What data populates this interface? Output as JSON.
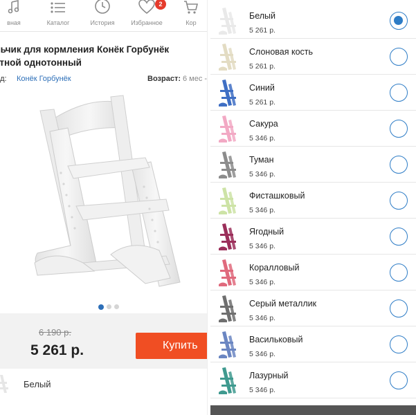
{
  "tabbar": {
    "tabs": [
      {
        "label": "вная",
        "icon": "music-note-icon"
      },
      {
        "label": "Каталог",
        "icon": "catalog-list-icon"
      },
      {
        "label": "История",
        "icon": "history-clock-icon"
      },
      {
        "label": "Избранное",
        "icon": "heart-icon",
        "badge": "2"
      },
      {
        "label": "Кор",
        "icon": "cart-icon"
      }
    ]
  },
  "product": {
    "title_line1": "льчик для кормления Конёк Горбунёк",
    "title_line2": "етной однотонный",
    "brand_key": "нд:",
    "brand_value": "Конёк Горбунёк",
    "age_key": "Возраст:",
    "age_value": "6 мес -",
    "old_price": "6 190 р.",
    "price": "5 261 р.",
    "buy_label": "Купить",
    "selected_color": "Белый",
    "gallery_pages": 3,
    "gallery_current": 1
  },
  "colors": {
    "accent": "#2d7cc6",
    "buy_button": "#f04e23",
    "badge": "#e53b2c"
  },
  "options": [
    {
      "name": "Белый",
      "price": "5 261 р.",
      "color": "#e9e9e9",
      "checked": true
    },
    {
      "name": "Слоновая кость",
      "price": "5 261 р.",
      "color": "#e3dcc3",
      "checked": false
    },
    {
      "name": "Синий",
      "price": "5 261 р.",
      "color": "#3f6fc4",
      "checked": false
    },
    {
      "name": "Сакура",
      "price": "5 346 р.",
      "color": "#f2a9c4",
      "checked": false
    },
    {
      "name": "Туман",
      "price": "5 346 р.",
      "color": "#8c8c8c",
      "checked": false
    },
    {
      "name": "Фисташковый",
      "price": "5 346 р.",
      "color": "#cde3a6",
      "checked": false
    },
    {
      "name": "Ягодный",
      "price": "5 346 р.",
      "color": "#9b2f5a",
      "checked": false
    },
    {
      "name": "Коралловый",
      "price": "5 346 р.",
      "color": "#e06a7d",
      "checked": false
    },
    {
      "name": "Серый металлик",
      "price": "5 346 р.",
      "color": "#6f6f6f",
      "checked": false
    },
    {
      "name": "Васильковый",
      "price": "5 346 р.",
      "color": "#6b86c2",
      "checked": false
    },
    {
      "name": "Лазурный",
      "price": "5 346 р.",
      "color": "#3f9a8f",
      "checked": false
    }
  ]
}
